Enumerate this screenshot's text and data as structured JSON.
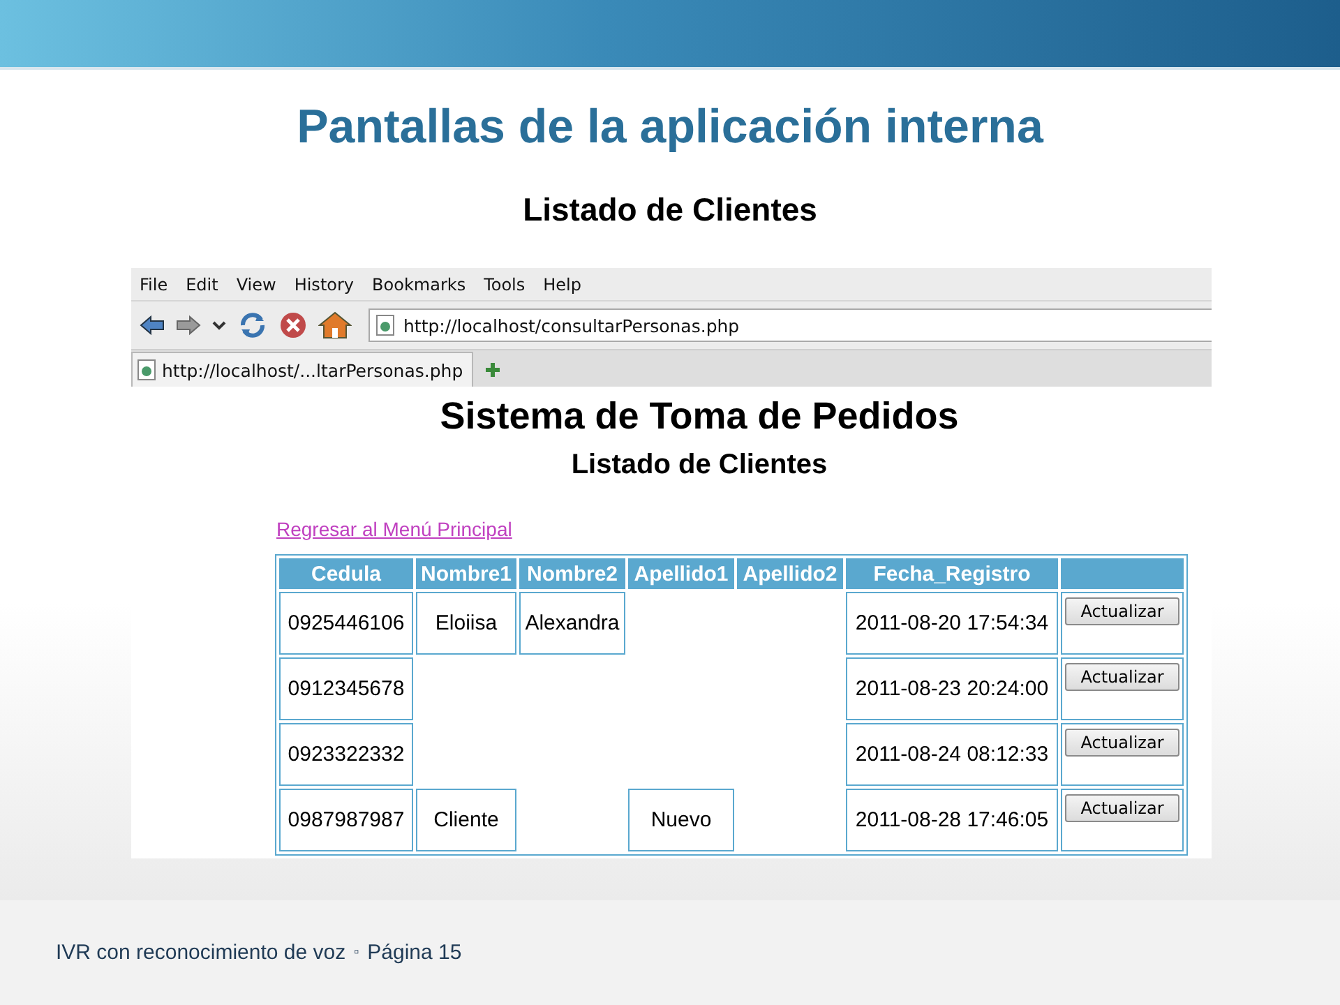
{
  "slide": {
    "title": "Pantallas de la aplicación interna",
    "subtitle": "Listado de Clientes"
  },
  "browser": {
    "menu": [
      "File",
      "Edit",
      "View",
      "History",
      "Bookmarks",
      "Tools",
      "Help"
    ],
    "address": "http://localhost/consultarPersonas.php",
    "tabs": [
      {
        "label": "http://localhost/...ltarPersonas.php",
        "selected": true
      }
    ],
    "page": {
      "heading": "Sistema de Toma de Pedidos",
      "subheading": "Listado de Clientes",
      "link": "Regresar al Menú Principal",
      "table": {
        "columns": [
          "Cedula",
          "Nombre1",
          "Nombre2",
          "Apellido1",
          "Apellido2",
          "Fecha_Registro"
        ],
        "rows": [
          {
            "cells": [
              "0925446106",
              "Eloiisa",
              "Alexandra",
              null,
              null,
              "2011-08-20 17:54:34"
            ],
            "action": "Actualizar"
          },
          {
            "cells": [
              "0912345678",
              null,
              null,
              null,
              null,
              "2011-08-23 20:24:00"
            ],
            "action": "Actualizar"
          },
          {
            "cells": [
              "0923322332",
              null,
              null,
              null,
              null,
              "2011-08-24 08:12:33"
            ],
            "action": "Actualizar"
          },
          {
            "cells": [
              "0987987987",
              "Cliente",
              null,
              "Nuevo",
              null,
              "2011-08-28 17:46:05"
            ],
            "action": "Actualizar"
          }
        ]
      }
    }
  },
  "footer": {
    "text": "IVR con reconocimiento de  voz",
    "separator": "▫",
    "page": "Página 15"
  }
}
